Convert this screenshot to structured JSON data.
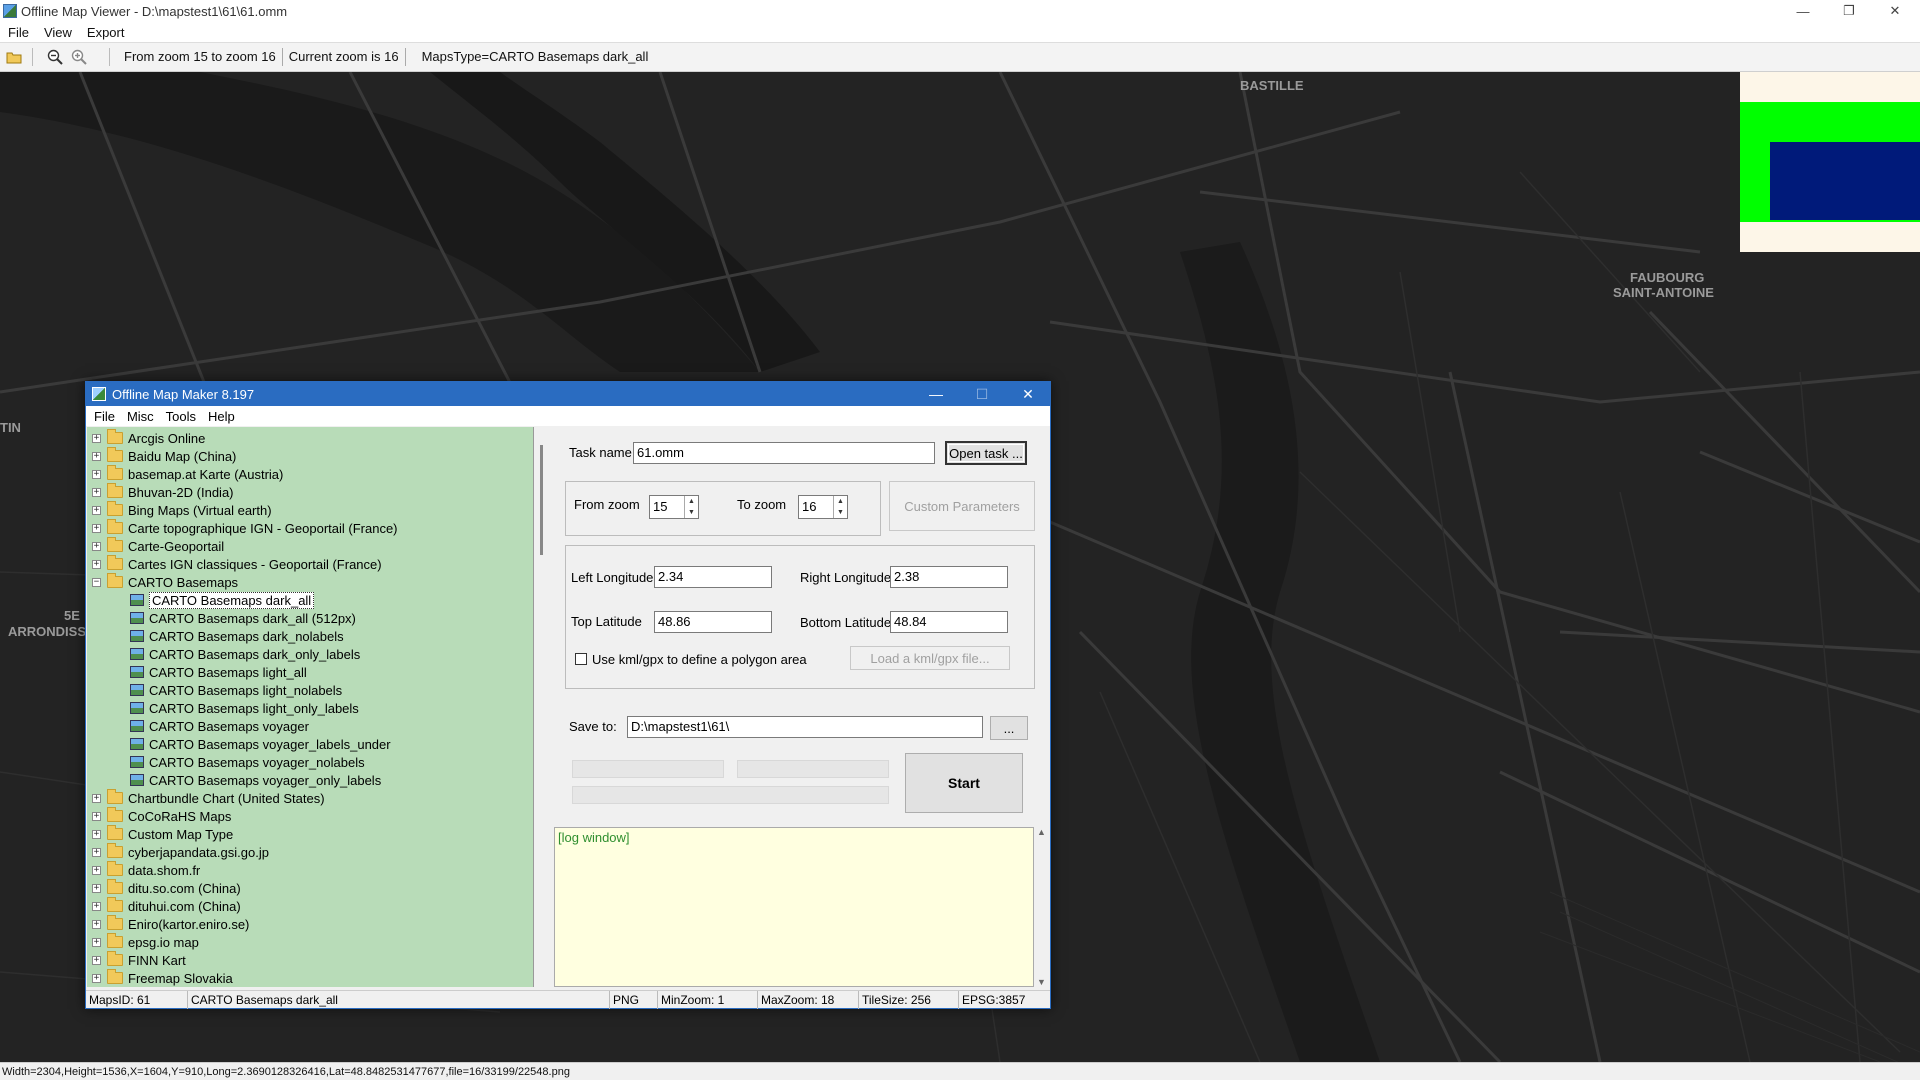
{
  "viewer": {
    "title": "Offline Map Viewer - D:\\mapstest1\\61\\61.omm",
    "menu": [
      "File",
      "View",
      "Export"
    ],
    "toolbar": {
      "zoom_range": "From zoom 15 to zoom 16",
      "current_zoom": "Current zoom is 16",
      "maps_type": "MapsType=CARTO Basemaps dark_all"
    },
    "status": "Width=2304,Height=1536,X=1604,Y=910,Long=2.3690128326416,Lat=48.8482531477677,file=16/33199/22548.png",
    "map_labels": {
      "bastille": "BASTILLE",
      "faubourg_1": "FAUBOURG",
      "faubourg_2": "SAINT-ANTOINE",
      "arr_1": "5E",
      "arr_2": "ARRONDISS",
      "tin": "TIN"
    },
    "minimap_colors": {
      "frame": "#fdf6e8",
      "area": "#00ff00",
      "region": "#001a7a"
    }
  },
  "maker": {
    "title": "Offline Map Maker 8.197",
    "menu": [
      "File",
      "Misc",
      "Tools",
      "Help"
    ],
    "tree": [
      {
        "label": "Arcgis Online",
        "type": "folder",
        "expanded": false
      },
      {
        "label": "Baidu Map (China)",
        "type": "folder",
        "expanded": false
      },
      {
        "label": "basemap.at Karte (Austria)",
        "type": "folder",
        "expanded": false
      },
      {
        "label": "Bhuvan-2D (India)",
        "type": "folder",
        "expanded": false
      },
      {
        "label": "Bing Maps (Virtual earth)",
        "type": "folder",
        "expanded": false
      },
      {
        "label": "Carte topographique IGN - Geoportail (France)",
        "type": "folder",
        "expanded": false
      },
      {
        "label": "Carte-Geoportail",
        "type": "folder",
        "expanded": false
      },
      {
        "label": "Cartes IGN classiques - Geoportail (France)",
        "type": "folder",
        "expanded": false
      },
      {
        "label": "CARTO Basemaps",
        "type": "folder",
        "expanded": true
      },
      {
        "label": "CARTO Basemaps dark_all",
        "type": "map",
        "selected": true
      },
      {
        "label": "CARTO Basemaps dark_all (512px)",
        "type": "map"
      },
      {
        "label": "CARTO Basemaps dark_nolabels",
        "type": "map"
      },
      {
        "label": "CARTO Basemaps dark_only_labels",
        "type": "map"
      },
      {
        "label": "CARTO Basemaps light_all",
        "type": "map"
      },
      {
        "label": "CARTO Basemaps light_nolabels",
        "type": "map"
      },
      {
        "label": "CARTO Basemaps light_only_labels",
        "type": "map"
      },
      {
        "label": "CARTO Basemaps voyager",
        "type": "map"
      },
      {
        "label": "CARTO Basemaps voyager_labels_under",
        "type": "map"
      },
      {
        "label": "CARTO Basemaps voyager_nolabels",
        "type": "map"
      },
      {
        "label": "CARTO Basemaps voyager_only_labels",
        "type": "map"
      },
      {
        "label": "Chartbundle Chart (United States)",
        "type": "folder",
        "expanded": false
      },
      {
        "label": "CoCoRaHS Maps",
        "type": "folder",
        "expanded": false
      },
      {
        "label": "Custom Map Type",
        "type": "folder",
        "expanded": false
      },
      {
        "label": "cyberjapandata.gsi.go.jp",
        "type": "folder",
        "expanded": false
      },
      {
        "label": "data.shom.fr",
        "type": "folder",
        "expanded": false
      },
      {
        "label": "ditu.so.com (China)",
        "type": "folder",
        "expanded": false
      },
      {
        "label": "dituhui.com (China)",
        "type": "folder",
        "expanded": false
      },
      {
        "label": "Eniro(kartor.eniro.se)",
        "type": "folder",
        "expanded": false
      },
      {
        "label": "epsg.io map",
        "type": "folder",
        "expanded": false
      },
      {
        "label": "FINN Kart",
        "type": "folder",
        "expanded": false
      },
      {
        "label": "Freemap Slovakia",
        "type": "folder",
        "expanded": false
      }
    ],
    "form": {
      "task_name_label": "Task name",
      "task_name_value": "61.omm",
      "open_task": "Open task ...",
      "from_zoom_label": "From zoom",
      "from_zoom_value": "15",
      "to_zoom_label": "To zoom",
      "to_zoom_value": "16",
      "custom_params": "Custom Parameters",
      "left_lon_label": "Left Longitude",
      "left_lon_value": "2.34",
      "right_lon_label": "Right Longitude",
      "right_lon_value": "2.38",
      "top_lat_label": "Top Latitude",
      "top_lat_value": "48.86",
      "bottom_lat_label": "Bottom Latitude",
      "bottom_lat_value": "48.84",
      "kml_label": "Use kml/gpx to define a polygon area",
      "kml_checked": false,
      "load_kml": "Load a kml/gpx file...",
      "save_to_label": "Save to:",
      "save_to_value": "D:\\mapstest1\\61\\",
      "browse": "...",
      "start": "Start",
      "log": "[log window]"
    },
    "status": {
      "maps_id": "MapsID: 61",
      "map_name": "CARTO Basemaps dark_all",
      "format": "PNG",
      "min_zoom": "MinZoom: 1",
      "max_zoom": "MaxZoom: 18",
      "tile_size": "TileSize: 256",
      "epsg": "EPSG:3857"
    }
  }
}
